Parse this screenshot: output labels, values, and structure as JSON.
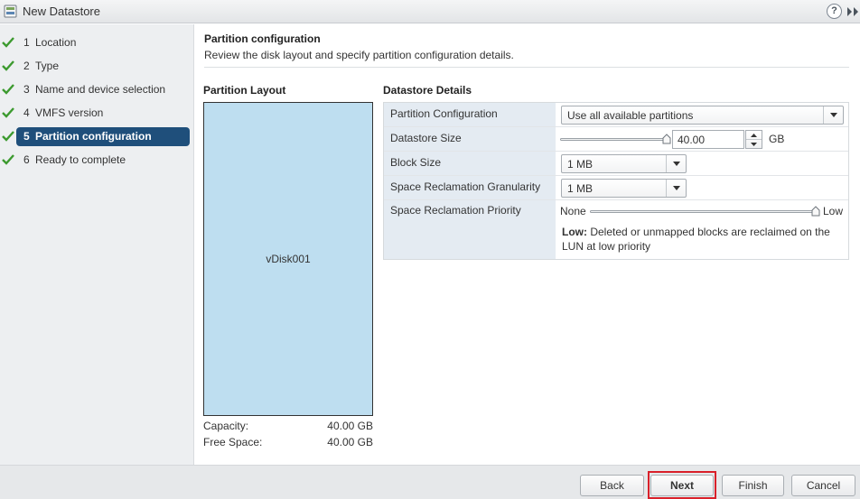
{
  "window": {
    "title": "New Datastore",
    "help_label": "?",
    "app_icon": "datastore-icon",
    "expand_icon": "double-chevron-right-icon"
  },
  "steps": [
    {
      "num": "1",
      "label": "Location",
      "completed": true,
      "active": false
    },
    {
      "num": "2",
      "label": "Type",
      "completed": true,
      "active": false
    },
    {
      "num": "3",
      "label": "Name and device selection",
      "completed": true,
      "active": false
    },
    {
      "num": "4",
      "label": "VMFS version",
      "completed": true,
      "active": false
    },
    {
      "num": "5",
      "label": "Partition configuration",
      "completed": true,
      "active": true
    },
    {
      "num": "6",
      "label": "Ready to complete",
      "completed": true,
      "active": false
    }
  ],
  "page": {
    "title": "Partition configuration",
    "description": "Review the disk layout and specify partition configuration details."
  },
  "layout": {
    "title": "Partition Layout",
    "disk_name": "vDisk001",
    "capacity_label": "Capacity:",
    "capacity_value": "40.00 GB",
    "free_label": "Free Space:",
    "free_value": "40.00 GB"
  },
  "details": {
    "title": "Datastore Details",
    "partition_config": {
      "label": "Partition Configuration",
      "value": "Use all available partitions"
    },
    "datastore_size": {
      "label": "Datastore Size",
      "value": "40.00",
      "unit": "GB",
      "slider_fraction": 1.0
    },
    "block_size": {
      "label": "Block Size",
      "value": "1 MB"
    },
    "granularity": {
      "label": "Space Reclamation Granularity",
      "value": "1 MB"
    },
    "priority": {
      "label": "Space Reclamation Priority",
      "min_label": "None",
      "max_label": "Low",
      "slider_fraction": 1.0,
      "note_strong": "Low:",
      "note_line1": " Deleted or unmapped blocks are reclaimed on the",
      "note_line2": "LUN at low priority"
    }
  },
  "buttons": {
    "back": "Back",
    "next": "Next",
    "finish": "Finish",
    "cancel": "Cancel"
  },
  "colors": {
    "active_step": "#1f4f7b",
    "check": "#3c9a2f",
    "disk_fill": "#bedef0",
    "label_cell": "#e4ebf2",
    "next_highlight": "#d9202a"
  }
}
